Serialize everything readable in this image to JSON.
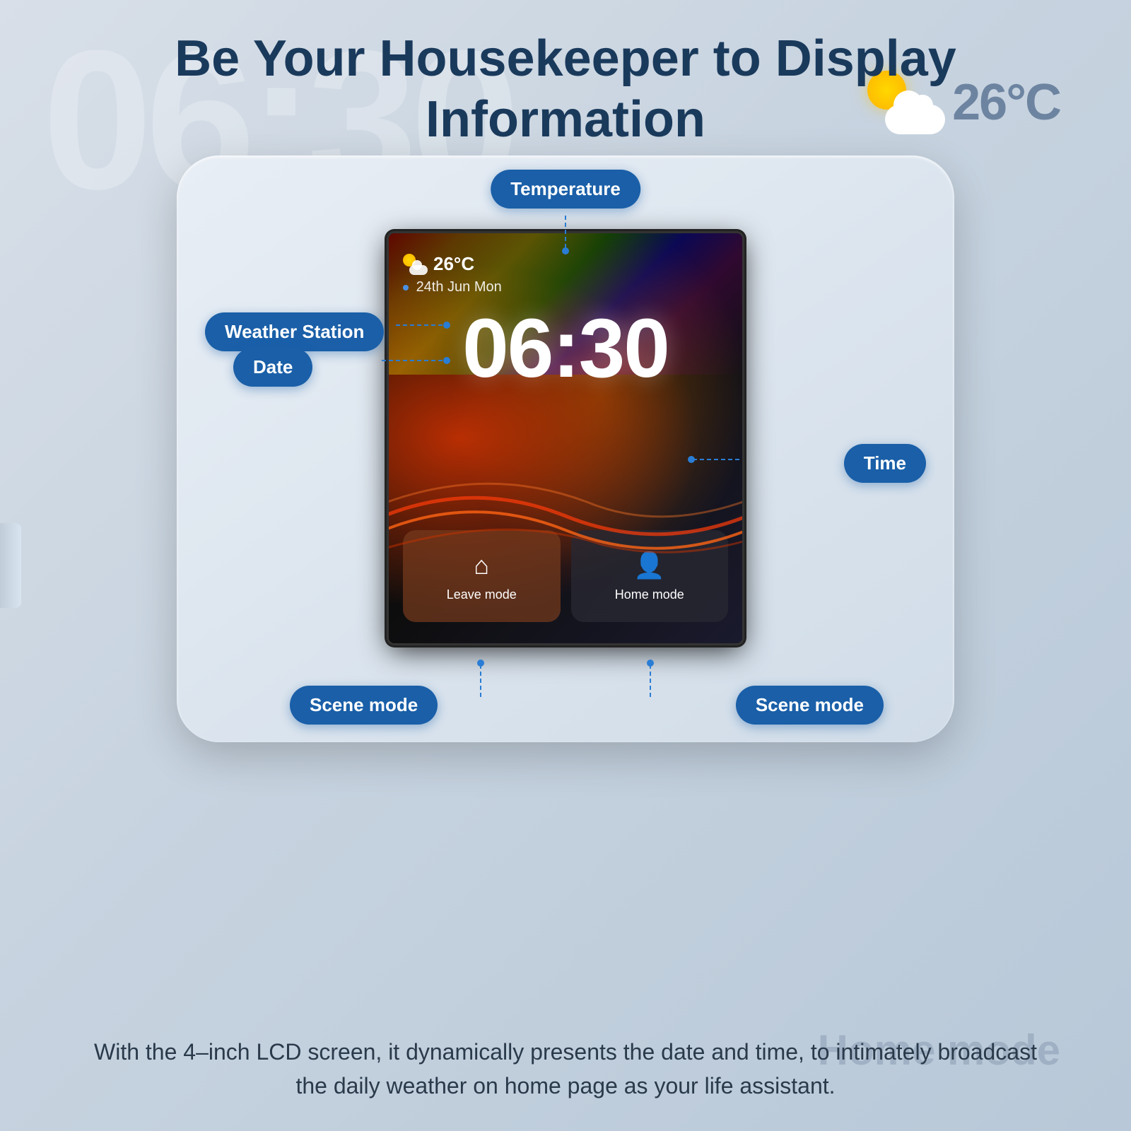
{
  "page": {
    "title": "Be Your Housekeeper to Display Information",
    "title_line1": "Be Your Housekeeper to Display",
    "title_line2": "Information"
  },
  "bg_deco": {
    "clock_text": "06",
    "temp_text": "26°C"
  },
  "device": {
    "screen": {
      "weather_temp": "26°C",
      "date": "24th Jun  Mon",
      "time": "06:30",
      "leave_mode_label": "Leave mode",
      "home_mode_label": "Home mode"
    }
  },
  "annotations": {
    "temperature_label": "Temperature",
    "weather_station_label": "Weather Station",
    "date_label": "Date",
    "time_label": "Time",
    "scene_mode_left_label": "Scene mode",
    "scene_mode_right_label": "Scene mode"
  },
  "bottom_text": "With the 4–inch LCD screen, it dynamically presents the date and time, to intimately broadcast the daily weather on home page as your life assistant.",
  "bg_watermark": "Home mode",
  "colors": {
    "annotation_bg": "#1a5fa8",
    "dashed_line": "#2a7dd4",
    "heading": "#1a3a5c",
    "body_text": "#2a3a4a"
  }
}
